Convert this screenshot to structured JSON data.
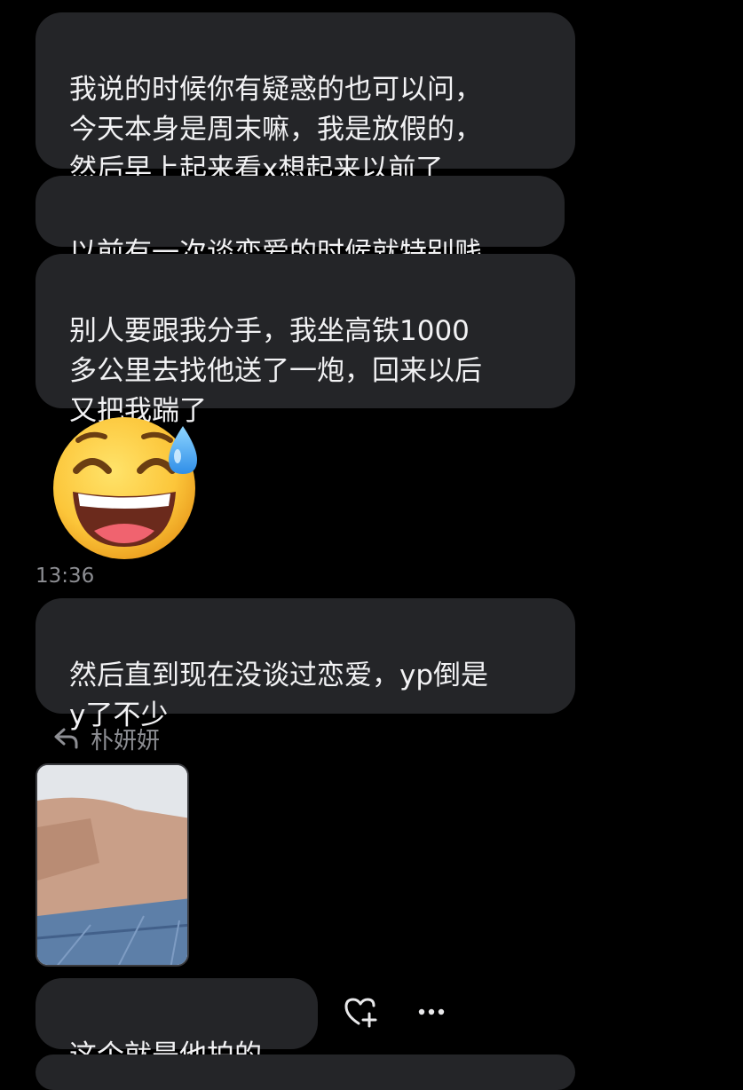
{
  "messages": [
    {
      "text": "我说的时候你有疑惑的也可以问，\n今天本身是周末嘛，我是放假的，\n然后早上起来看x想起来以前了"
    },
    {
      "text": "以前有一次谈恋爱的时候就特别贱"
    },
    {
      "text": "别人要跟我分手，我坐高铁1000\n多公里去找他送了一炮，回来以后\n又把我踹了"
    },
    {
      "text": "然后直到现在没谈过恋爱，yp倒是\ny了不少"
    },
    {
      "text": "这个就是他拍的"
    }
  ],
  "timestamp": "13:36",
  "reply": {
    "name": "朴妍妍",
    "icon": "reply-arrow-icon"
  },
  "emoji": {
    "name": "grinning-face-with-sweat"
  },
  "icons": {
    "react": "heart-plus-icon",
    "more": "more-horizontal-icon"
  },
  "colors": {
    "background": "#000000",
    "bubble": "#242528",
    "text": "#f2f2f4",
    "muted": "#8d8e93"
  }
}
